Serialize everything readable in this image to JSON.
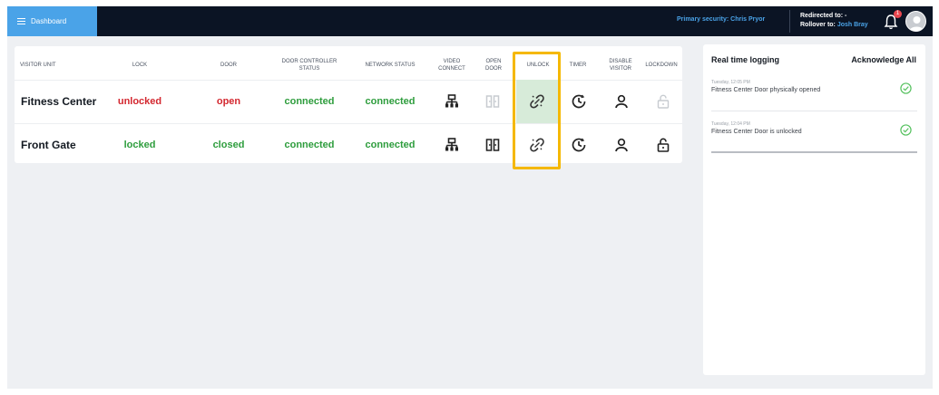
{
  "header": {
    "dashboard_label": "Dashboard",
    "primary_security": "Primary security: Chris Pryor",
    "redirected_label": "Redirected to:",
    "redirected_value": "-",
    "rollover_label": "Rollover to:",
    "rollover_value": "Josh Bray",
    "notification_count": "1"
  },
  "table": {
    "columns": [
      "VISITOR UNIT",
      "LOCK",
      "DOOR",
      "DOOR CONTROLLER STATUS",
      "NETWORK STATUS",
      "VIDEO CONNECT",
      "OPEN DOOR",
      "UNLOCK",
      "TIMER",
      "DISABLE VISITOR",
      "LOCKDOWN"
    ],
    "rows": [
      {
        "unit": "Fitness Center",
        "lock": "unlocked",
        "door": "open",
        "controller": "connected",
        "network": "connected"
      },
      {
        "unit": "Front Gate",
        "lock": "locked",
        "door": "closed",
        "controller": "connected",
        "network": "connected"
      }
    ]
  },
  "log": {
    "title": "Real time logging",
    "acknowledge_all": "Acknowledge All",
    "entries": [
      {
        "time": "Tuesday, 12:05 PM",
        "message": "Fitness Center Door physically opened"
      },
      {
        "time": "Tuesday, 12:04 PM",
        "message": "Fitness Center Door is unlocked"
      }
    ]
  },
  "colors": {
    "accent": "#4aa3e8",
    "topbar": "#0b1424",
    "status_red": "#d3272f",
    "status_green": "#2e9d3d",
    "highlight": "#f5b800",
    "unlock_active_bg": "#d7ebd9"
  },
  "icons": {
    "video_connect": "network-icon",
    "open_door": "door-icon",
    "unlock": "broken-link-icon",
    "timer": "clock-icon",
    "disable_visitor": "user-icon",
    "lockdown": "padlock-icon"
  }
}
